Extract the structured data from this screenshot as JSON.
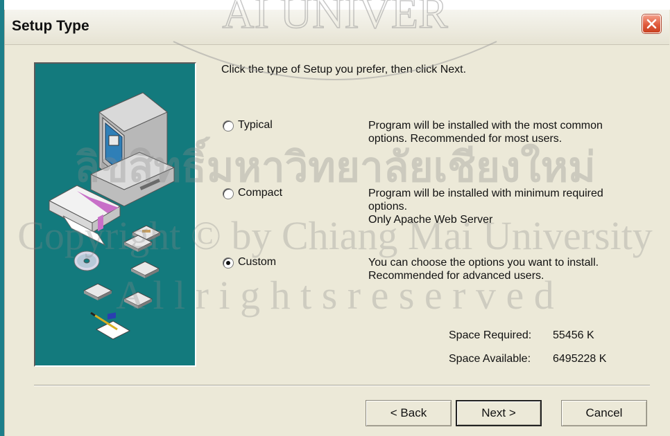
{
  "window": {
    "title": "Setup Type"
  },
  "instruction": "Click the type of Setup you prefer, then click Next.",
  "options": [
    {
      "label": "Typical",
      "selected": false,
      "description": [
        "Program will be installed with the most common",
        "options. Recommended for most users."
      ]
    },
    {
      "label": "Compact",
      "selected": false,
      "description": [
        "Program will be installed with minimum required",
        "options.",
        "Only Apache Web Server"
      ]
    },
    {
      "label": "Custom",
      "selected": true,
      "description": [
        "You can choose the options you want to install.",
        "Recommended for advanced users."
      ]
    }
  ],
  "space": {
    "required_label": "Space Required:",
    "required_value": "55456 K",
    "available_label": "Space Available:",
    "available_value": "6495228 K"
  },
  "buttons": {
    "back": "< Back",
    "next": "Next >",
    "cancel": "Cancel"
  },
  "watermark": {
    "line1": "AI UNIVER",
    "line2": "ลิขสิทธิ์มหาวิทยาลัยเชียงใหม่",
    "line3": "Copyright © by Chiang Mai University",
    "line4": "A l l   r i g h t s   r e s e r v e d"
  },
  "colors": {
    "dialog_bg": "#ece9d8",
    "illustration_bg": "#137a7d",
    "close_button": "#e05a3c"
  }
}
